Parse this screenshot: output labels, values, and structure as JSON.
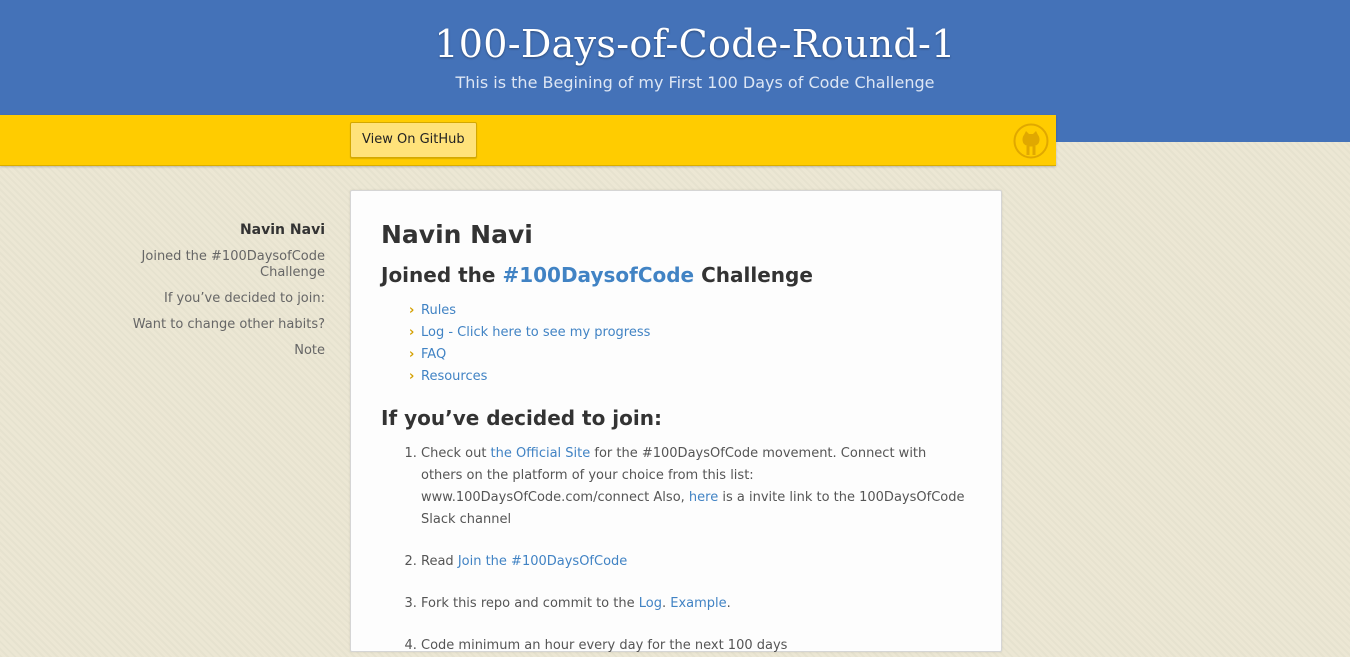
{
  "header": {
    "title": "100-Days-of-Code-Round-1",
    "subtitle": "This is the Begining of my First 100 Days of Code Challenge"
  },
  "nav": {
    "github_button": "View On GitHub",
    "octocat_icon": "octocat-icon"
  },
  "sidebar": {
    "title": "Navin Navi",
    "items": [
      "Joined the #100DaysofCode Challenge",
      "If you’ve decided to join:",
      "Want to change other habits?",
      "Note"
    ]
  },
  "content": {
    "name": "Navin Navi",
    "joined": {
      "before": "Joined the ",
      "link": "#100DaysofCode",
      "after": " Challenge"
    },
    "links": [
      "Rules",
      "Log - Click here to see my progress",
      "FAQ",
      "Resources"
    ],
    "bullet": "›",
    "join_heading": "If you’ve decided to join:",
    "steps": {
      "s1": {
        "a": "Check out ",
        "link1": "the Official Site",
        "b": " for the #100DaysOfCode movement. Connect with others on the platform of your choice from this list: www.100DaysOfCode.com/connect Also, ",
        "link2": "here",
        "c": " is a invite link to the 100DaysOfCode Slack channel"
      },
      "s2": {
        "a": "Read ",
        "link": "Join the #100DaysOfCode"
      },
      "s3": {
        "a": "Fork this repo and commit to the ",
        "link1": "Log",
        "sep": ". ",
        "link2": "Example",
        "end": "."
      },
      "s4": {
        "a": "Code minimum an hour every day for the next 100 days"
      }
    }
  },
  "colors": {
    "header_bg": "#4472b8",
    "nav_bg": "#ffcc00",
    "link": "#4183c4",
    "page_bg": "#ece7d4"
  }
}
